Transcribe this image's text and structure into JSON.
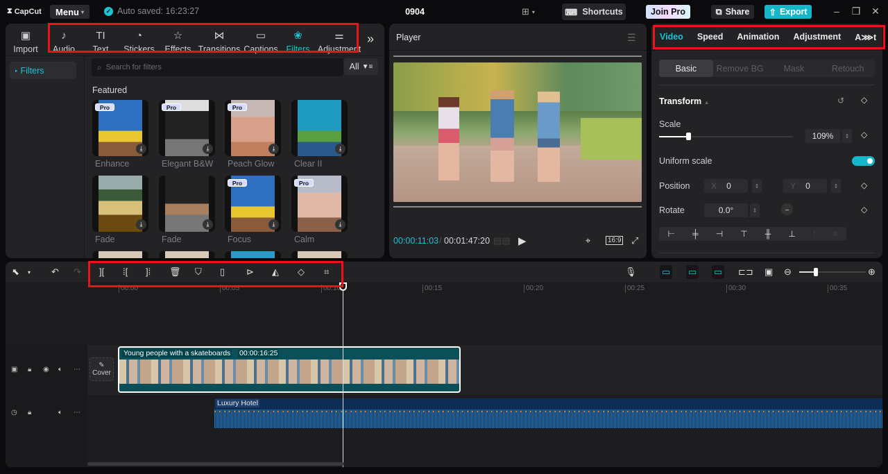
{
  "app": {
    "logo": "CapCut",
    "menu_label": "Menu",
    "autosave": "Auto saved: 16:23:27",
    "project_title": "0904",
    "shortcuts_label": "Shortcuts",
    "join_pro_label": "Join Pro",
    "share_label": "Share",
    "export_label": "Export"
  },
  "media": {
    "tabs": [
      {
        "label": "Import",
        "icon": "import-icon",
        "glyph": "▣"
      },
      {
        "label": "Audio",
        "icon": "audio-icon",
        "glyph": "♪"
      },
      {
        "label": "Text",
        "icon": "text-icon",
        "glyph": "TI"
      },
      {
        "label": "Stickers",
        "icon": "sticker-icon",
        "glyph": "◔"
      },
      {
        "label": "Effects",
        "icon": "effects-icon",
        "glyph": "☆"
      },
      {
        "label": "Transitions",
        "icon": "transitions-icon",
        "glyph": "⋈"
      },
      {
        "label": "Captions",
        "icon": "captions-icon",
        "glyph": "▭"
      },
      {
        "label": "Filters",
        "icon": "filters-icon",
        "glyph": "❀"
      },
      {
        "label": "Adjustment",
        "icon": "adjustment-icon",
        "glyph": "⚌"
      }
    ],
    "active_tab": "Filters",
    "more_label": "»",
    "sidebar_item": "Filters",
    "search_placeholder": "Search for filters",
    "all_label": "All",
    "section_title": "Featured",
    "filters": [
      {
        "name": "Enhance",
        "pro": true
      },
      {
        "name": "Elegant B&W",
        "pro": true
      },
      {
        "name": "Peach Glow",
        "pro": true
      },
      {
        "name": "Clear II",
        "pro": false
      },
      {
        "name": "Fade",
        "pro": false
      },
      {
        "name": "Fade",
        "pro": false
      },
      {
        "name": "Focus",
        "pro": true
      },
      {
        "name": "Calm",
        "pro": true
      }
    ],
    "pro_badge": "Pro"
  },
  "player": {
    "title": "Player",
    "current_time": "00:00:11:03",
    "total_time": "00:01:47:20",
    "ratio_label": "16:9"
  },
  "inspector": {
    "tabs": [
      "Video",
      "Speed",
      "Animation",
      "Adjustment",
      "A⋙t"
    ],
    "active_tab": "Video",
    "sub_tabs": [
      "Basic",
      "Remove BG",
      "Mask",
      "Retouch"
    ],
    "active_sub_tab": "Basic",
    "transform_label": "Transform",
    "scale_label": "Scale",
    "scale_value": "109%",
    "scale_slider_fraction": 0.22,
    "uniform_scale_label": "Uniform scale",
    "uniform_scale_on": true,
    "position_label": "Position",
    "position_x_label": "X",
    "position_x": "0",
    "position_y_label": "Y",
    "position_y": "0",
    "rotate_label": "Rotate",
    "rotate_value": "0.0°"
  },
  "timeline": {
    "ruler_labels": [
      "00:00",
      "00:05",
      "00:10",
      "00:15",
      "00:20",
      "00:25",
      "00:30",
      "00:35"
    ],
    "video_clip_title": "Young people with a skateboards",
    "video_clip_duration": "00:00:16:25",
    "audio_clip_title": "Luxury Hotel",
    "cover_label": "Cover",
    "zoom_fraction": 0.25
  }
}
